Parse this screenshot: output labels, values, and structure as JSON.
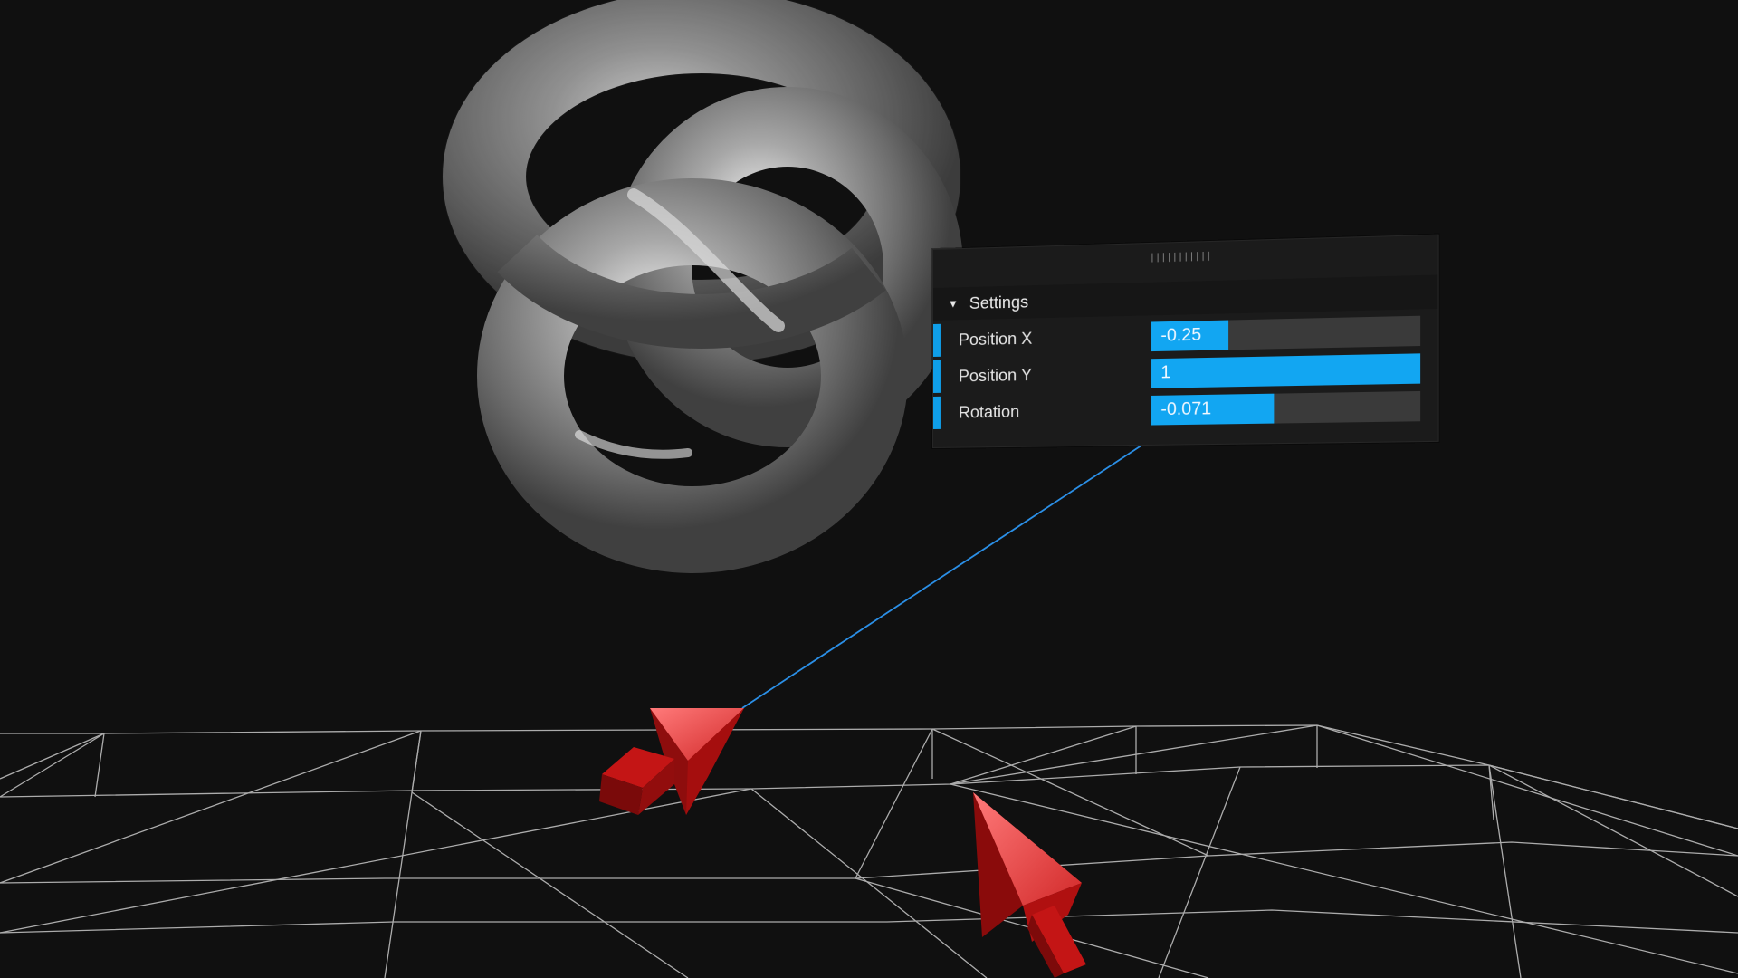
{
  "panel": {
    "grip_glyph": "|||||||||||",
    "section_title": "Settings",
    "collapse_glyph": "▼",
    "rows": [
      {
        "label": "Position X",
        "value": "-0.25",
        "fill": 0.29
      },
      {
        "label": "Position Y",
        "value": "1",
        "fill": 1.0
      },
      {
        "label": "Rotation",
        "value": "-0.071",
        "fill": 0.46
      }
    ]
  },
  "colors": {
    "background": "#101010",
    "accent": "#12a6f2",
    "controller": "#c41010",
    "knot": "#8a8a8a",
    "grid": "#bdbdbd"
  },
  "icons": {
    "controller_left": "pointer-arrow-icon",
    "controller_right": "pointer-arrow-icon",
    "collapse": "triangle-down-icon",
    "grip": "drag-handle-icon"
  }
}
